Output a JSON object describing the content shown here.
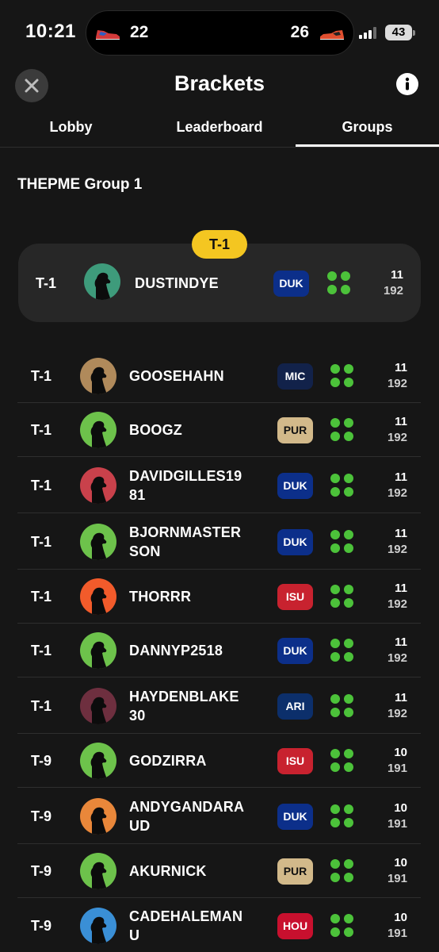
{
  "status_bar": {
    "time": "10:21",
    "score_left": "22",
    "score_right": "26",
    "battery": "43"
  },
  "header": {
    "title": "Brackets"
  },
  "tabs": [
    {
      "label": "Lobby",
      "active": false
    },
    {
      "label": "Leaderboard",
      "active": false
    },
    {
      "label": "Groups",
      "active": true
    }
  ],
  "group": {
    "name": "THEPME Group 1"
  },
  "leader": {
    "badge": "T-1",
    "rank": "T-1",
    "name": "DUSTINDYE",
    "team": "DUK",
    "points": "11",
    "total": "192",
    "avatar_color": "#3e9b7b"
  },
  "rows": [
    {
      "rank": "T-1",
      "name_lines": [
        "GOOSEHAHN",
        ""
      ],
      "team": "MIC",
      "points": "11",
      "total": "192",
      "avatar_color": "#b08a5b"
    },
    {
      "rank": "T-1",
      "name_lines": [
        "BOOGZ",
        ""
      ],
      "team": "PUR",
      "points": "11",
      "total": "192",
      "avatar_color": "#6dc24b"
    },
    {
      "rank": "T-1",
      "name_lines": [
        "DAVIDGILLES19",
        "81"
      ],
      "team": "DUK",
      "points": "11",
      "total": "192",
      "avatar_color": "#c9414b"
    },
    {
      "rank": "T-1",
      "name_lines": [
        "BJORNMASTER",
        "SON"
      ],
      "team": "DUK",
      "points": "11",
      "total": "192",
      "avatar_color": "#6dc24b"
    },
    {
      "rank": "T-1",
      "name_lines": [
        "THORRR",
        ""
      ],
      "team": "ISU",
      "points": "11",
      "total": "192",
      "avatar_color": "#f25b2b"
    },
    {
      "rank": "T-1",
      "name_lines": [
        "DANNYP2518",
        ""
      ],
      "team": "DUK",
      "points": "11",
      "total": "192",
      "avatar_color": "#6dc24b"
    },
    {
      "rank": "T-1",
      "name_lines": [
        "HAYDENBLAKE",
        "30"
      ],
      "team": "ARI",
      "points": "11",
      "total": "192",
      "avatar_color": "#6e2f3f"
    },
    {
      "rank": "T-9",
      "name_lines": [
        "GODZIRRA",
        ""
      ],
      "team": "ISU",
      "points": "10",
      "total": "191",
      "avatar_color": "#6dc24b"
    },
    {
      "rank": "T-9",
      "name_lines": [
        "ANDYGANDARA",
        "UD"
      ],
      "team": "DUK",
      "points": "10",
      "total": "191",
      "avatar_color": "#e9873a"
    },
    {
      "rank": "T-9",
      "name_lines": [
        "AKURNICK",
        ""
      ],
      "team": "PUR",
      "points": "10",
      "total": "191",
      "avatar_color": "#6dc24b"
    },
    {
      "rank": "T-9",
      "name_lines": [
        "CADEHALEMAN",
        "U"
      ],
      "team": "HOU",
      "points": "10",
      "total": "191",
      "avatar_color": "#3a8fd6"
    }
  ],
  "team_colors": {
    "DUK": {
      "bg": "#0c2f8a",
      "fg": "#ffffff"
    },
    "MIC": {
      "bg": "#12224a",
      "fg": "#ffffff"
    },
    "PUR": {
      "bg": "#d2b98a",
      "fg": "#111111"
    },
    "ISU": {
      "bg": "#c8222f",
      "fg": "#ffffff"
    },
    "ARI": {
      "bg": "#0c2f6b",
      "fg": "#ffffff"
    },
    "HOU": {
      "bg": "#c8102e",
      "fg": "#ffffff"
    }
  },
  "colors": {
    "accent": "#f4c621",
    "dots": "#4cc23a",
    "background": "#161616"
  }
}
